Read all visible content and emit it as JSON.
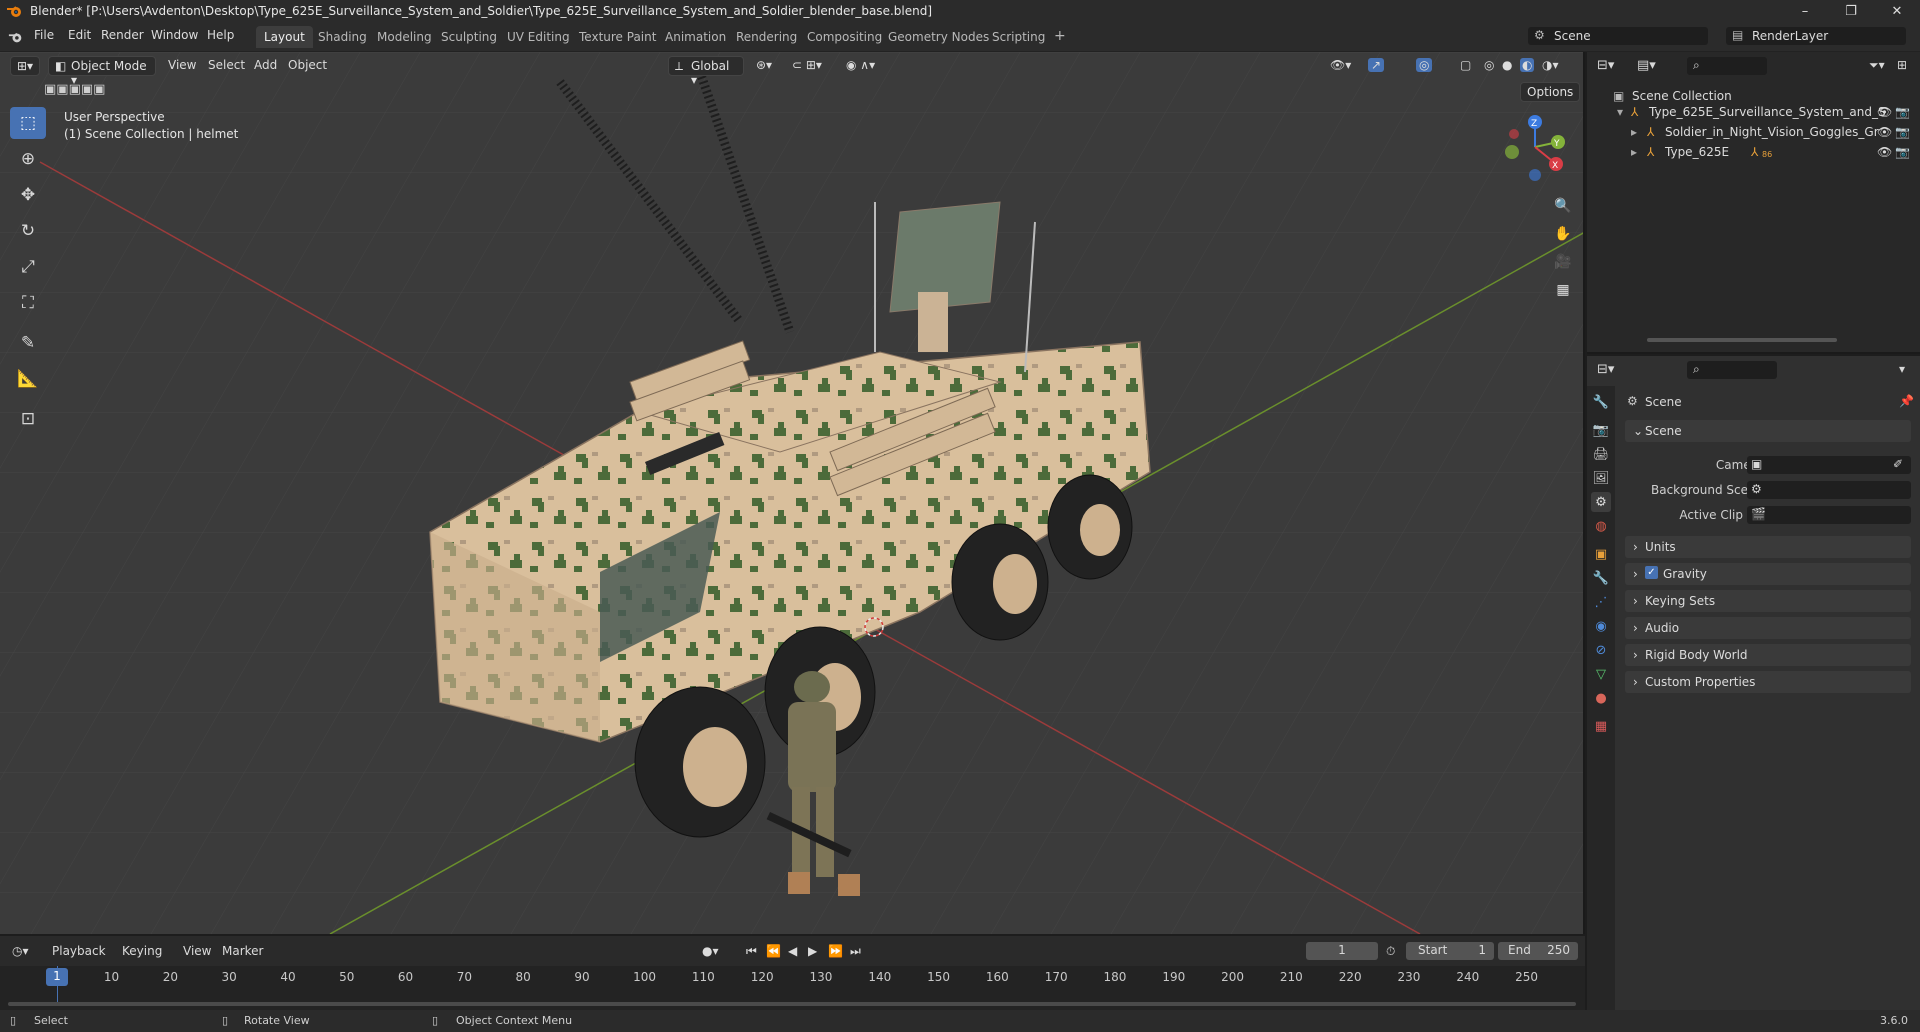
{
  "window": {
    "title": "Blender* [P:\\Users\\Avdenton\\Desktop\\Type_625E_Surveillance_System_and_Soldier\\Type_625E_Surveillance_System_and_Soldier_blender_base.blend]",
    "minimize": "–",
    "maximize": "❐",
    "close": "✕"
  },
  "menu": {
    "items": [
      "File",
      "Edit",
      "Render",
      "Window",
      "Help"
    ],
    "workspaces": [
      "Layout",
      "Shading",
      "Modeling",
      "Sculpting",
      "UV Editing",
      "Texture Paint",
      "Animation",
      "Rendering",
      "Compositing",
      "Geometry Nodes",
      "Scripting"
    ],
    "add_workspace": "+",
    "scene": "Scene",
    "view_layer": "RenderLayer"
  },
  "viewport": {
    "mode": "Object Mode",
    "menus": [
      "View",
      "Select",
      "Add",
      "Object"
    ],
    "transform_orientation": "Global",
    "options": "Options",
    "overlay_line1": "User Perspective",
    "overlay_line2": "(1) Scene Collection | helmet",
    "gizmo": {
      "z": "Z",
      "y": "Y",
      "x": "X"
    }
  },
  "outliner": {
    "root": "Scene Collection",
    "items": [
      {
        "name": "Type_625E_Surveillance_System_and_S"
      },
      {
        "name": "Soldier_in_Night_Vision_Goggles_Gr"
      },
      {
        "name": "Type_625E",
        "badge": "86"
      }
    ]
  },
  "properties": {
    "header": "Scene",
    "panel_scene": "Scene",
    "fields": [
      {
        "label": "Camera"
      },
      {
        "label": "Background Scene"
      },
      {
        "label": "Active Clip"
      }
    ],
    "panels": [
      "Units",
      "Gravity",
      "Keying Sets",
      "Audio",
      "Rigid Body World",
      "Custom Properties"
    ]
  },
  "timeline": {
    "menus": [
      "Playback",
      "Keying",
      "View",
      "Marker"
    ],
    "current_frame": "1",
    "start_label": "Start",
    "start": "1",
    "end_label": "End",
    "end": "250",
    "ticks": [
      "1",
      "10",
      "20",
      "30",
      "40",
      "50",
      "60",
      "70",
      "80",
      "90",
      "100",
      "110",
      "120",
      "130",
      "140",
      "150",
      "160",
      "170",
      "180",
      "190",
      "200",
      "210",
      "220",
      "230",
      "240",
      "250"
    ]
  },
  "statusbar": {
    "select": "Select",
    "rotate": "Rotate View",
    "context": "Object Context Menu",
    "version": "3.6.0"
  }
}
